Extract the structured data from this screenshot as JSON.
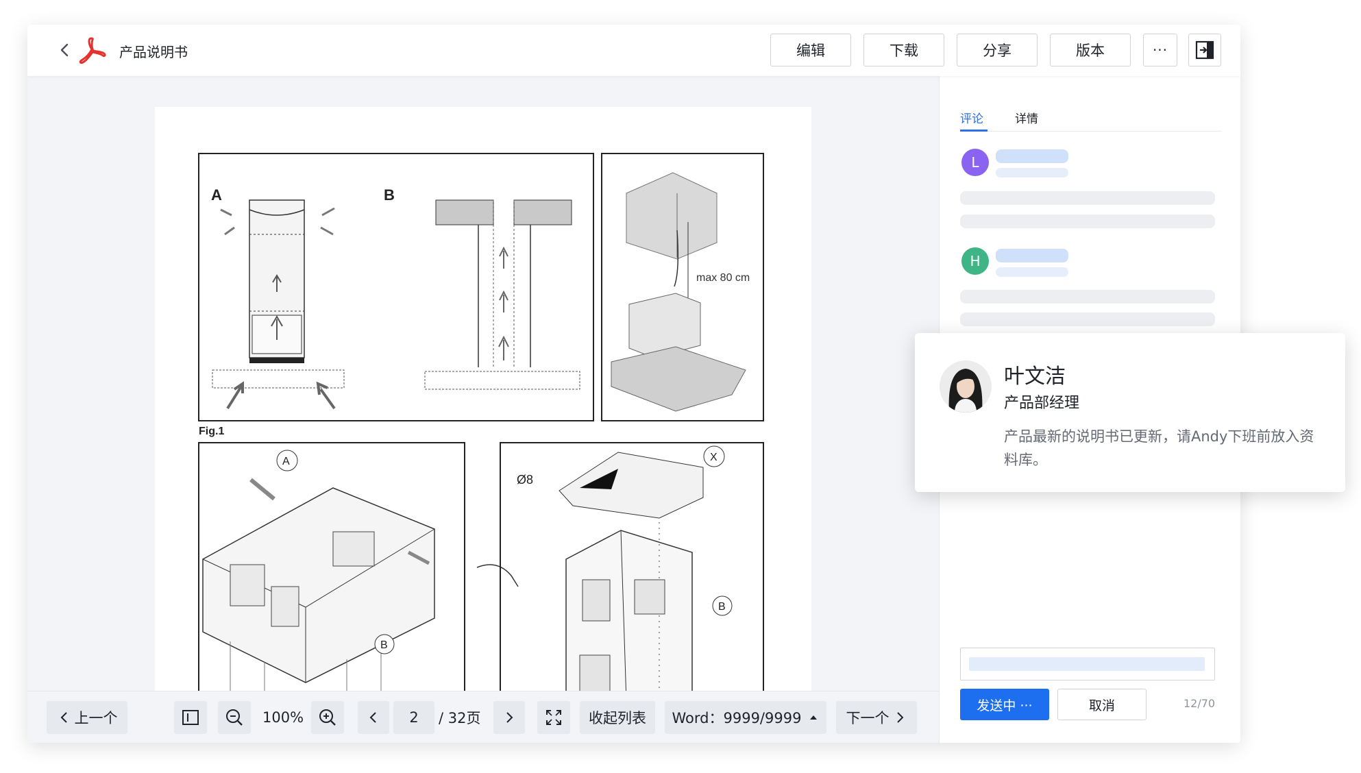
{
  "header": {
    "title": "产品说明书",
    "buttons": [
      "编辑",
      "下载",
      "分享",
      "版本"
    ],
    "more_label": "···"
  },
  "document": {
    "fig_label": "Fig.1",
    "panel_a_label": "A",
    "panel_b_label": "B",
    "dimension_label": "max 80 cm",
    "callout_a": "A",
    "callout_b": "B",
    "callout_x": "X",
    "diameter_label": "Ø8"
  },
  "toolbar": {
    "prev": "上一个",
    "zoom": "100%",
    "page_current": "2",
    "page_total": "/ 32页",
    "collapse": "收起列表",
    "word_count": "Word：9999/9999",
    "next": "下一个"
  },
  "sidebar": {
    "tabs": [
      "评论",
      "详情"
    ],
    "active_tab": 0,
    "comments": [
      {
        "initial": "L",
        "color": "#8a63f0"
      },
      {
        "initial": "H",
        "color": "#3fb487"
      }
    ],
    "send_label": "发送中 ···",
    "cancel_label": "取消",
    "counter": "12/70"
  },
  "popup": {
    "name": "叶文洁",
    "role": "产品部经理",
    "message": "产品最新的说明书已更新，请Andy下班前放入资料库。"
  },
  "colors": {
    "accent": "#1e6ff0",
    "pdf_red": "#e5322d"
  }
}
